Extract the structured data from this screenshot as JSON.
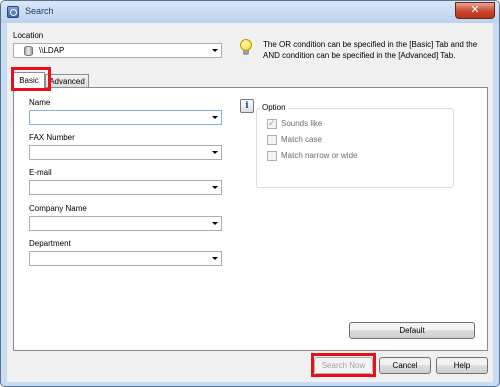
{
  "window": {
    "title": "Search",
    "close_label": "✕"
  },
  "location": {
    "label": "Location",
    "value": "\\\\LDAP"
  },
  "tip": {
    "text": "The OR condition can be specified in the [Basic] Tab and the AND condition can be specified in the [Advanced] Tab."
  },
  "tabs": [
    {
      "label": "Basic",
      "selected": true
    },
    {
      "label": "Advanced",
      "selected": false
    }
  ],
  "fields": [
    {
      "label": "Name",
      "value": ""
    },
    {
      "label": "FAX Number",
      "value": ""
    },
    {
      "label": "E-mail",
      "value": ""
    },
    {
      "label": "Company Name",
      "value": ""
    },
    {
      "label": "Department",
      "value": ""
    }
  ],
  "option": {
    "title": "Option",
    "info_glyph": "i",
    "checkboxes": [
      {
        "label": "Sounds like",
        "checked": true,
        "enabled": false
      },
      {
        "label": "Match case",
        "checked": false,
        "enabled": false
      },
      {
        "label": "Match narrow or wide",
        "checked": false,
        "enabled": false
      }
    ]
  },
  "buttons": {
    "default": "Default",
    "search_now": "Search Now",
    "cancel": "Cancel",
    "help": "Help"
  },
  "highlight_color": "#e8101a"
}
